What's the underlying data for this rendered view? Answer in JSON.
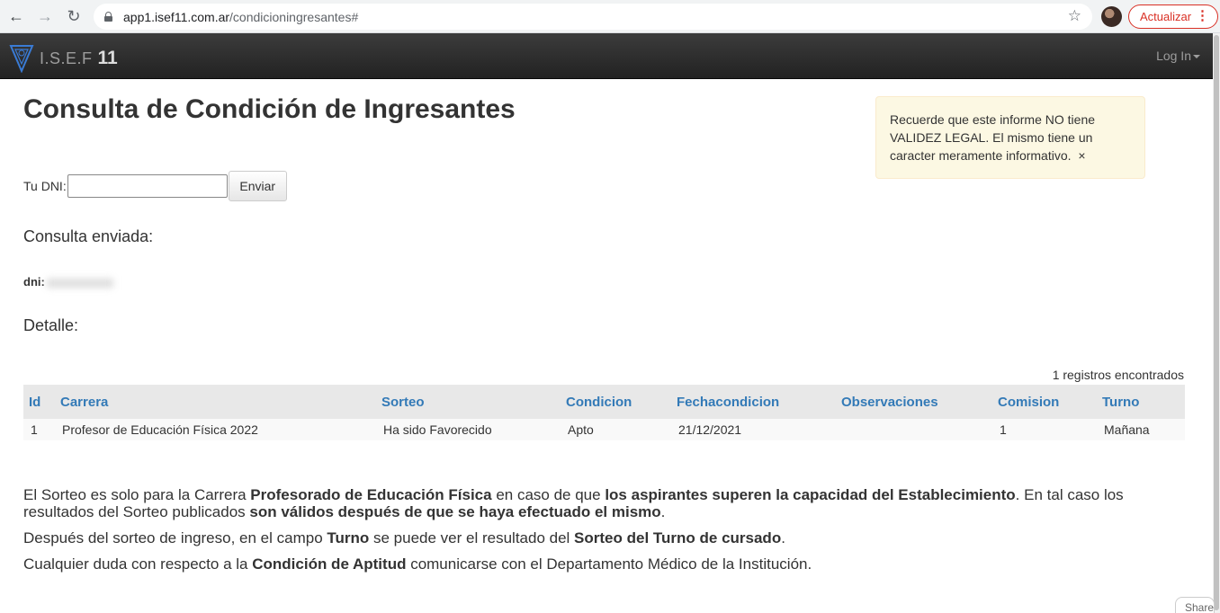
{
  "browser": {
    "url_host": "app1.isef11.com.ar",
    "url_path": "/condicioningresantes#",
    "update_label": "Actualizar"
  },
  "navbar": {
    "brand": "I.S.E.F",
    "brand_number": "11",
    "login_label": "Log In"
  },
  "page": {
    "title": "Consulta de Condición de Ingresantes",
    "alert": "Recuerde que este informe NO tiene VALIDEZ LEGAL. El mismo tiene un caracter meramente informativo.",
    "alert_close": "×",
    "dni_label": "Tu DNI:",
    "dni_value": "",
    "submit_label": "Enviar",
    "sent_heading": "Consulta enviada:",
    "dni_echo_label": "dni:",
    "detail_heading": "Detalle:",
    "records_found": "1 registros encontrados"
  },
  "table": {
    "headers": [
      "Id",
      "Carrera",
      "Sorteo",
      "Condicion",
      "Fechacondicion",
      "Observaciones",
      "Comision",
      "Turno"
    ],
    "rows": [
      [
        "1",
        "Profesor de Educación Física 2022",
        "Ha sido Favorecido",
        "Apto",
        "21/12/2021",
        "",
        "1",
        "Mañana"
      ]
    ]
  },
  "info": {
    "p1_a": "El Sorteo es solo para la Carrera ",
    "p1_b": "Profesorado de Educación Física",
    "p1_c": " en caso de que ",
    "p1_d": "los aspirantes superen la capacidad del Establecimiento",
    "p1_e": ". En tal caso los resultados del Sorteo publicados ",
    "p1_f": "son válidos después de que se haya efectuado el mismo",
    "p1_g": ".",
    "p2_a": "Después del sorteo de ingreso, en el campo ",
    "p2_b": "Turno",
    "p2_c": " se puede ver el resultado del ",
    "p2_d": "Sorteo del Turno de cursado",
    "p2_e": ".",
    "p3_a": "Cualquier duda con respecto a la ",
    "p3_b": "Condición de Aptitud",
    "p3_c": " comunicarse con el Departamento Médico de la Institución."
  },
  "share_label": "Share",
  "colors": {
    "link": "#337ab7",
    "alert_bg": "#fcf8e3",
    "update": "#d93025"
  }
}
